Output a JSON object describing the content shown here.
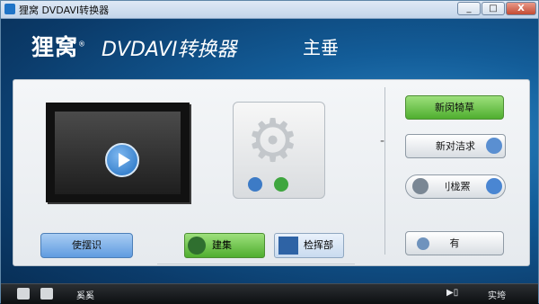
{
  "window": {
    "title": "狸窝 DVDAVI转换器",
    "min": "_",
    "max": "□",
    "close": "X"
  },
  "banner": {
    "brand": "狸窝",
    "registered": "®",
    "product": "DVDAVI转换器",
    "edition": "主垂"
  },
  "main": {
    "left_button": "使摆识",
    "tab1": "建集",
    "tab2": "检挥部",
    "right_buttons": [
      "新闵犄草",
      "新对洁求",
      "刂栊罴",
      "有"
    ],
    "dash": "-"
  },
  "status": {
    "left": "奚奚",
    "mid": "▶▯",
    "right": "实垮"
  }
}
